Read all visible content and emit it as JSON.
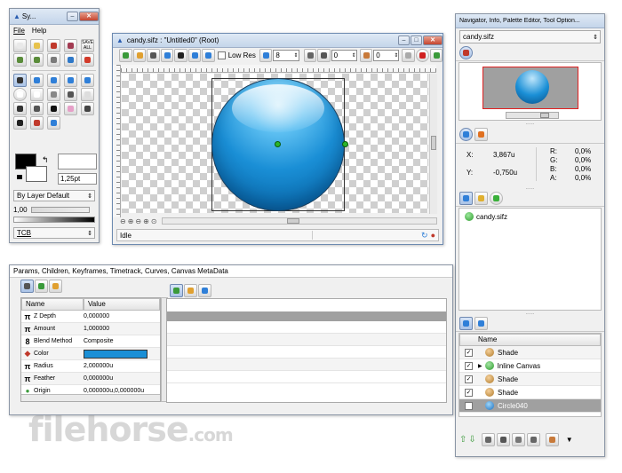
{
  "toolbox": {
    "title": "Sy...",
    "menu": [
      "File",
      "Help"
    ],
    "save_all": "SAVE ALL",
    "width": "1,25pt",
    "blend": "By Layer Default",
    "amount": "1,00",
    "bline": "TCB"
  },
  "canvas": {
    "title": "candy.sifz : \"Untitled0\" (Root)",
    "low_res": "Low Res",
    "spin1": "8",
    "spin2": "0",
    "spin3": "0",
    "status": "Idle"
  },
  "navigator": {
    "title": "Navigator, Info, Palette Editor, Tool Option...",
    "file": "candy.sifz",
    "info": {
      "x_label": "X:",
      "x": "3,867u",
      "y_label": "Y:",
      "y": "-0,750u",
      "r": "R:",
      "g": "G:",
      "b": "B:",
      "a": "A:",
      "rv": "0,0%",
      "gv": "0,0%",
      "bv": "0,0%",
      "av": "0,0%"
    },
    "canvases": [
      "candy.sifz"
    ],
    "layers_header": "Name",
    "layers": [
      {
        "name": "Shade",
        "checked": "✓"
      },
      {
        "name": "Inline Canvas",
        "checked": "✓"
      },
      {
        "name": "Shade",
        "checked": "✓"
      },
      {
        "name": "Shade",
        "checked": "✓"
      },
      {
        "name": "Circle040",
        "checked": "✓"
      }
    ]
  },
  "params": {
    "title": "Params, Children, Keyframes, Timetrack, Curves, Canvas MetaData",
    "col_name": "Name",
    "col_value": "Value",
    "rows": [
      {
        "name": "Z Depth",
        "value": "0,000000",
        "icon": "π"
      },
      {
        "name": "Amount",
        "value": "1,000000",
        "icon": "π"
      },
      {
        "name": "Blend Method",
        "value": "Composite",
        "icon": "8"
      },
      {
        "name": "Color",
        "value": "",
        "icon": "◆"
      },
      {
        "name": "Radius",
        "value": "2,000000u",
        "icon": "π"
      },
      {
        "name": "Feather",
        "value": "0,000000u",
        "icon": "π"
      },
      {
        "name": "Origin",
        "value": "0,000000u,0,000000u",
        "icon": "●"
      }
    ]
  },
  "watermark": {
    "text": "filehorse",
    "suffix": ".com"
  },
  "colors": {
    "circle": "#1a8fd6",
    "selection": "#a0a0a0",
    "accent": "#2f7fd8"
  }
}
